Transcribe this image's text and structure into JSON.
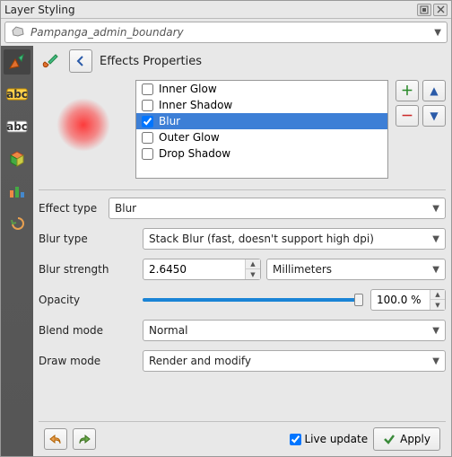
{
  "title": "Layer Styling",
  "layer_name": "Pampanga_admin_boundary",
  "header": "Effects Properties",
  "effects": {
    "items": [
      {
        "label": "Inner Glow",
        "checked": false,
        "selected": false
      },
      {
        "label": "Inner Shadow",
        "checked": false,
        "selected": false
      },
      {
        "label": "Blur",
        "checked": true,
        "selected": true
      },
      {
        "label": "Outer Glow",
        "checked": false,
        "selected": false
      },
      {
        "label": "Drop Shadow",
        "checked": false,
        "selected": false
      }
    ]
  },
  "form": {
    "effect_type_label": "Effect type",
    "effect_type_value": "Blur",
    "blur_type_label": "Blur type",
    "blur_type_value": "Stack Blur (fast, doesn't support high dpi)",
    "blur_strength_label": "Blur strength",
    "blur_strength_value": "2.6450",
    "blur_strength_unit": "Millimeters",
    "opacity_label": "Opacity",
    "opacity_value": "100.0 %",
    "opacity_pct": 100,
    "blend_mode_label": "Blend mode",
    "blend_mode_value": "Normal",
    "draw_mode_label": "Draw mode",
    "draw_mode_value": "Render and modify"
  },
  "footer": {
    "live_update_label": "Live update",
    "live_update_checked": true,
    "apply_label": "Apply"
  },
  "icons": {
    "add": "＋",
    "remove": "－",
    "up": "▲",
    "down": "▼"
  }
}
